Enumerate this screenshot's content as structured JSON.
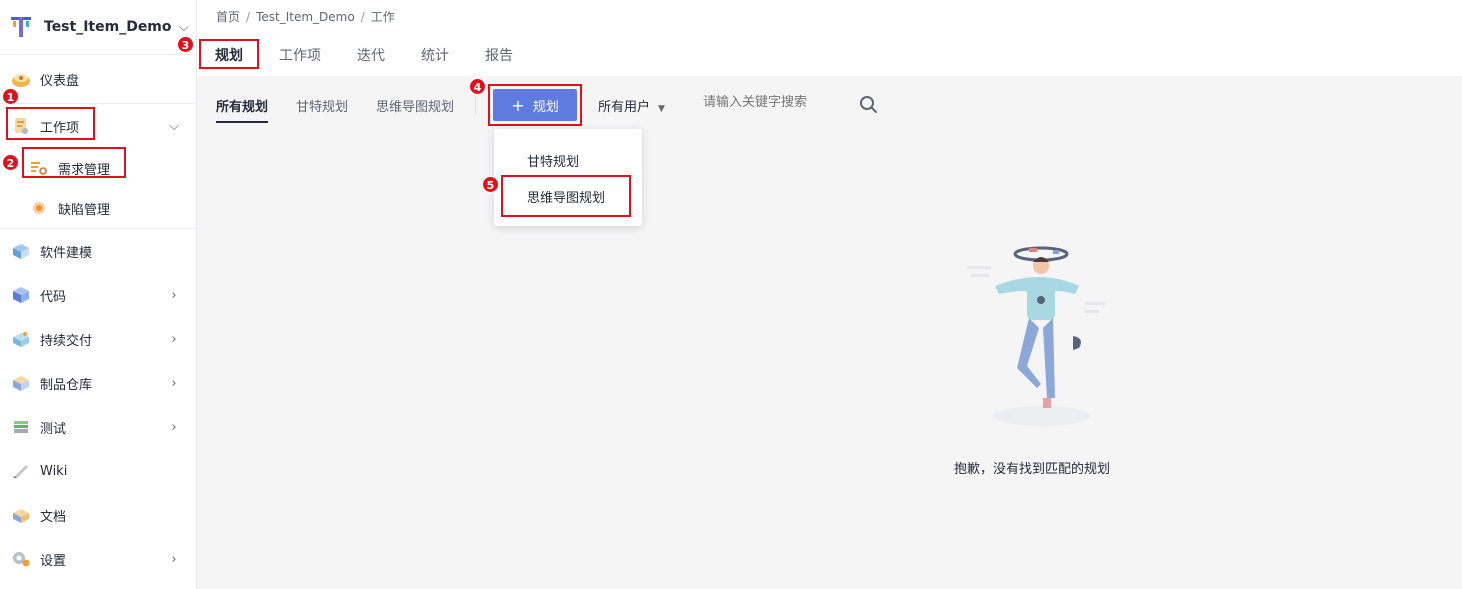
{
  "project": {
    "name": "Test_Item_Demo"
  },
  "sidebar": {
    "items": [
      {
        "label": "仪表盘",
        "icon": "dashboard-icon"
      },
      {
        "label": "工作项",
        "icon": "workitem-icon"
      },
      {
        "label": "需求管理",
        "icon": "requirement-icon"
      },
      {
        "label": "缺陷管理",
        "icon": "defect-icon"
      },
      {
        "label": "软件建模",
        "icon": "modeling-icon"
      },
      {
        "label": "代码",
        "icon": "code-icon"
      },
      {
        "label": "持续交付",
        "icon": "delivery-icon"
      },
      {
        "label": "制品仓库",
        "icon": "artifact-icon"
      },
      {
        "label": "测试",
        "icon": "test-icon"
      },
      {
        "label": "Wiki",
        "icon": "wiki-icon"
      },
      {
        "label": "文档",
        "icon": "document-icon"
      },
      {
        "label": "设置",
        "icon": "settings-icon"
      }
    ]
  },
  "breadcrumb": {
    "home": "首页",
    "project": "Test_Item_Demo",
    "current": "工作",
    "separator": "/"
  },
  "tabs": [
    "规划",
    "工作项",
    "迭代",
    "统计",
    "报告"
  ],
  "subtabs": [
    "所有规划",
    "甘特规划",
    "思维导图规划"
  ],
  "toolbar": {
    "plan_button": "规划",
    "user_filter": "所有用户",
    "search_placeholder": "请输入关键字搜索"
  },
  "dropdown": {
    "items": [
      "甘特规划",
      "思维导图规划"
    ]
  },
  "empty_state": {
    "message": "抱歉，没有找到匹配的规划"
  },
  "annotations": [
    "1",
    "2",
    "3",
    "4",
    "5"
  ],
  "colors": {
    "accent": "#5e7ce0",
    "annotation": "#e0111b"
  }
}
